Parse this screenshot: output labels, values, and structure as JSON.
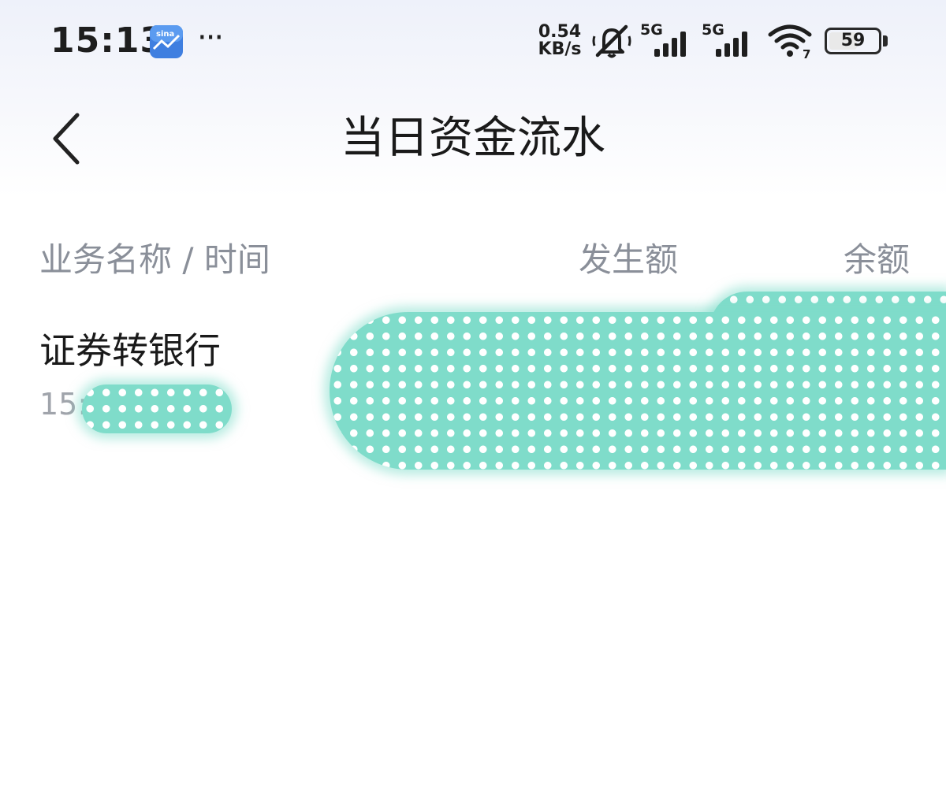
{
  "status_bar": {
    "time": "15:13",
    "more": "···",
    "net_speed_value": "0.54",
    "net_speed_unit": "KB/s",
    "signal_1_label": "5G",
    "signal_2_label": "5G",
    "wifi_label": "7",
    "battery_percent": "59",
    "battery_level": 0.59,
    "icons": [
      "finance-app-icon",
      "mute-icon",
      "signal-icon",
      "wifi-icon",
      "battery-icon"
    ]
  },
  "nav": {
    "back_icon": "chevron-left-icon",
    "title": "当日资金流水"
  },
  "table": {
    "columns": [
      "业务名称 / 时间",
      "发生额",
      "余额"
    ],
    "rows": [
      {
        "name": "证券转银行",
        "time": "15:"
      }
    ]
  },
  "colors": {
    "title": "#1a1a1a",
    "header_text": "#8a8f99",
    "time_text": "#a0a4ab",
    "redaction": "#7fdcca",
    "top_gradient": "#eef1fa"
  }
}
